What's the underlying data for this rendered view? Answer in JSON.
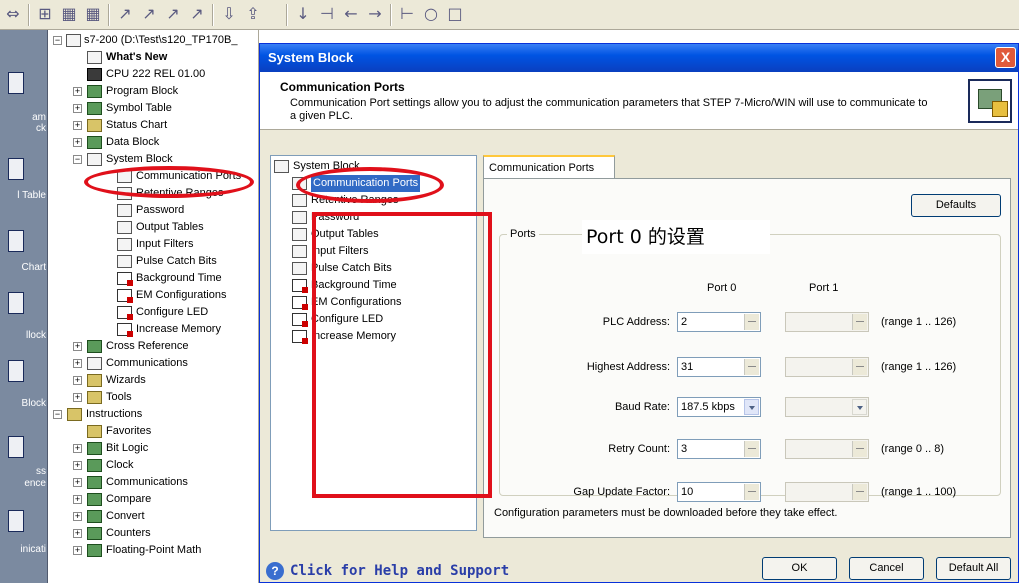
{
  "toolbar": {
    "icons": [
      "view-icon",
      "cross-ref-icon",
      "table-icon",
      "line-icon",
      "line-icon",
      "line-icon",
      "line-icon",
      "download-icon",
      "upload-icon",
      "contact-icon",
      "coil-icon",
      "left-arrow-icon",
      "right-arrow-icon",
      "box-icon"
    ]
  },
  "navbar": {
    "items": [
      {
        "label": "am\nck"
      },
      {
        "label": "l Table"
      },
      {
        "label": "Chart"
      },
      {
        "label": "llock"
      },
      {
        "label": "Block"
      },
      {
        "label": "ss\nence"
      },
      {
        "label": "inicati"
      }
    ]
  },
  "tree": {
    "root": "s7-200 (D:\\Test\\s120_TP170B_",
    "items": [
      {
        "label": "What's New",
        "bold": true
      },
      {
        "label": "CPU 222 REL 01.00"
      },
      {
        "label": "Program Block"
      },
      {
        "label": "Symbol Table"
      },
      {
        "label": "Status Chart"
      },
      {
        "label": "Data Block"
      },
      {
        "label": "System Block"
      },
      {
        "label": "Communication Ports"
      },
      {
        "label": "Retentive Ranges"
      },
      {
        "label": "Password"
      },
      {
        "label": "Output Tables"
      },
      {
        "label": "Input Filters"
      },
      {
        "label": "Pulse Catch Bits"
      },
      {
        "label": "Background Time"
      },
      {
        "label": "EM Configurations"
      },
      {
        "label": "Configure LED"
      },
      {
        "label": "Increase Memory"
      },
      {
        "label": "Cross Reference"
      },
      {
        "label": "Communications"
      },
      {
        "label": "Wizards"
      },
      {
        "label": "Tools"
      },
      {
        "label": "Instructions"
      },
      {
        "label": "Favorites"
      },
      {
        "label": "Bit Logic"
      },
      {
        "label": "Clock"
      },
      {
        "label": "Communications"
      },
      {
        "label": "Compare"
      },
      {
        "label": "Convert"
      },
      {
        "label": "Counters"
      },
      {
        "label": "Floating-Point Math"
      }
    ]
  },
  "dialog": {
    "title": "System Block",
    "close_label": "X",
    "header_title": "Communication Ports",
    "header_desc": "Communication Port settings allow you to adjust the communication parameters that STEP 7-Micro/WIN will use to communicate to a given PLC.",
    "tree": {
      "root": "System Block",
      "items": [
        "Communication Ports",
        "Retentive Ranges",
        "Password",
        "Output Tables",
        "Input Filters",
        "Pulse Catch Bits",
        "Background Time",
        "EM Configurations",
        "Configure LED",
        "Increase Memory"
      ]
    },
    "tab_label": "Communication Ports",
    "defaults_label": "Defaults",
    "ports_legend": "Ports",
    "annotation": "Port 0 的设置",
    "col_port0": "Port 0",
    "col_port1": "Port 1",
    "rows": [
      {
        "label": "PLC Address:",
        "port0": "2",
        "range": "(range 1 .. 126)"
      },
      {
        "label": "Highest Address:",
        "port0": "31",
        "range": "(range 1 .. 126)"
      },
      {
        "label": "Baud Rate:",
        "port0": "187.5 kbps",
        "range": ""
      },
      {
        "label": "Retry Count:",
        "port0": "3",
        "range": "(range 0 .. 8)"
      },
      {
        "label": "Gap Update Factor:",
        "port0": "10",
        "range": "(range 1 .. 100)"
      }
    ],
    "config_note": "Configuration parameters must be downloaded before they take effect.",
    "help_label": "Click for Help and Support",
    "ok_label": "OK",
    "cancel_label": "Cancel",
    "default_all_label": "Default All"
  },
  "colors": {
    "annotation_red": "#e0101a",
    "title_blue": "#0054e3"
  }
}
